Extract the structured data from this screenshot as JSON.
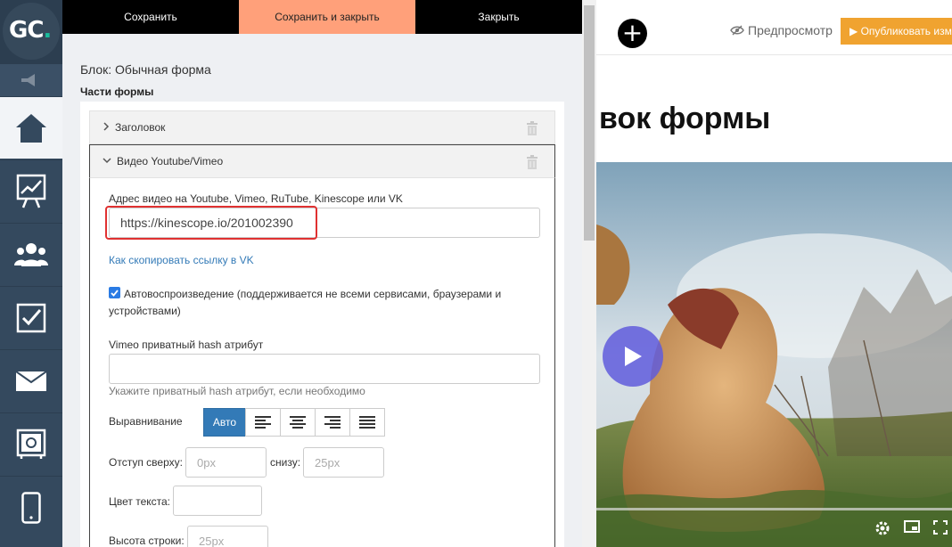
{
  "logo": {
    "text": "GC",
    "dot": "."
  },
  "toolbar": {
    "save": "Сохранить",
    "save_close": "Сохранить и закрыть",
    "close": "Закрыть"
  },
  "editor": {
    "block_title": "Блок: Обычная форма",
    "parts_title": "Части формы",
    "parts": [
      {
        "label": "Заголовок",
        "expanded": false
      },
      {
        "label": "Видео Youtube/Vimeo",
        "expanded": true
      }
    ],
    "video_url_label": "Адрес видео на Youtube, Vimeo, RuTube, Kinescope или VK",
    "video_url_value": "https://kinescope.io/201002390",
    "vk_link": "Как скопировать ссылку в VK",
    "autoplay_checked": true,
    "autoplay_line1": "Автовоспроизведение (поддерживается не всеми сервисами, браузерами и",
    "autoplay_line2": "устройствами)",
    "vimeo_hash_label": "Vimeo приватный hash атрибут",
    "vimeo_hash_value": "",
    "vimeo_hash_help": "Укажите приватный hash атрибут, если необходимо",
    "align_label": "Выравнивание",
    "align_auto": "Авто",
    "align_options": [
      "left-align-icon",
      "center-align-icon",
      "right-align-icon",
      "justify-align-icon"
    ],
    "margin_top_label": "Отступ сверху:",
    "margin_top_placeholder": "0px",
    "margin_bottom_label": "снизу:",
    "margin_bottom_placeholder": "25px",
    "text_color_label": "Цвет текста:",
    "line_height_label": "Высота строки:",
    "line_height_placeholder": "25px"
  },
  "preview": {
    "preview_label": "Предпросмотр",
    "publish_label": "▶ Опубликовать изм",
    "title_fragment": "вок формы"
  },
  "colors": {
    "nav": "#34495e",
    "accent": "#ffa07a",
    "publish": "#f0a330",
    "link": "#337ab7",
    "highlight": "#e03131",
    "play": "#605cdc"
  }
}
